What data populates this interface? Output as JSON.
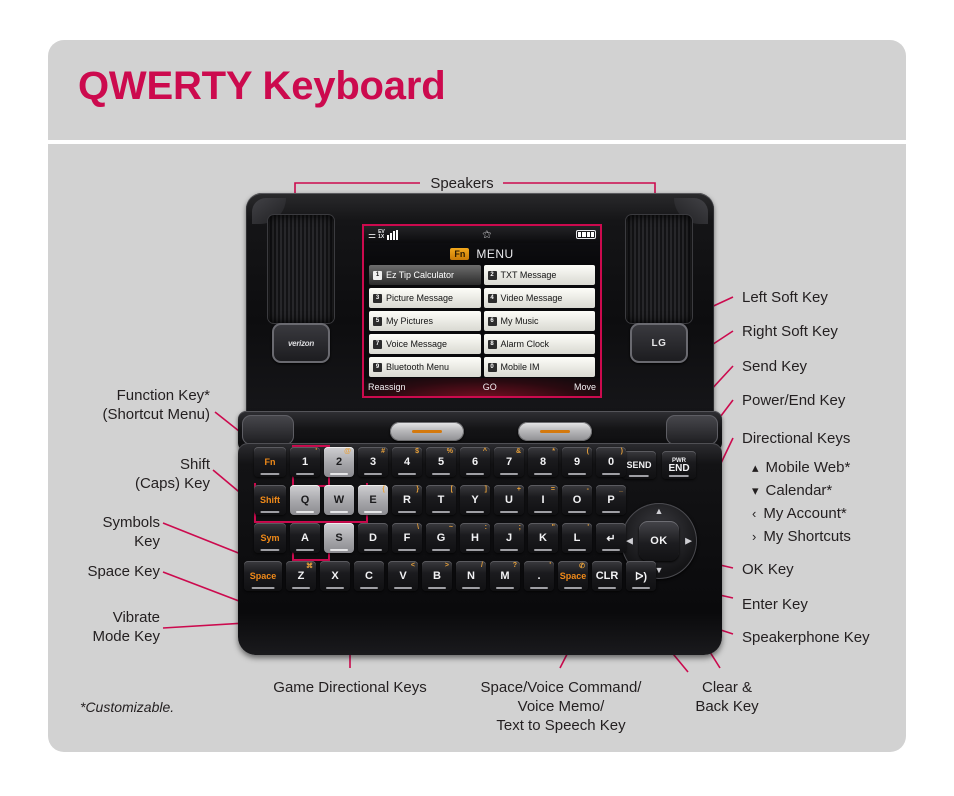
{
  "page": {
    "title": "QWERTY Keyboard",
    "accent_color": "#cc0a4e",
    "card_bg": "#d2d2d2",
    "footnote": "*Customizable."
  },
  "top_callout": {
    "speakers": "Speakers"
  },
  "phone": {
    "brand_left": "verizon",
    "brand_right": "LG",
    "screen": {
      "status": {
        "signal_icon": "antenna-icon",
        "network": "EV\n1X",
        "bars": 4,
        "gps_icon": "gps-crosshair-icon",
        "battery_icon": "battery-full-icon",
        "battery_level": 4
      },
      "header": {
        "fn_badge": "Fn",
        "title": "MENU"
      },
      "menu_items": [
        {
          "num": "1",
          "label": "Ez Tip Calculator",
          "selected": true
        },
        {
          "num": "2",
          "label": "TXT Message",
          "selected": false
        },
        {
          "num": "3",
          "label": "Picture Message",
          "selected": false
        },
        {
          "num": "4",
          "label": "Video Message",
          "selected": false
        },
        {
          "num": "5",
          "label": "My Pictures",
          "selected": false
        },
        {
          "num": "6",
          "label": "My Music",
          "selected": false
        },
        {
          "num": "7",
          "label": "Voice Message",
          "selected": false
        },
        {
          "num": "8",
          "label": "Alarm Clock",
          "selected": false
        },
        {
          "num": "9",
          "label": "Bluetooth Menu",
          "selected": false
        },
        {
          "num": "0",
          "label": "Mobile IM",
          "selected": false
        }
      ],
      "soft_bar": {
        "left": "Reassign",
        "center": "GO",
        "right": "Move"
      }
    },
    "keyboard": {
      "row1": [
        {
          "main": "Fn",
          "sup": "",
          "style": "orange"
        },
        {
          "main": "1",
          "sup": "'",
          "style": "dark"
        },
        {
          "main": "2",
          "sup": "@",
          "style": "lite"
        },
        {
          "main": "3",
          "sup": "#",
          "style": "dark"
        },
        {
          "main": "4",
          "sup": "$",
          "style": "dark"
        },
        {
          "main": "5",
          "sup": "%",
          "style": "dark"
        },
        {
          "main": "6",
          "sup": "^",
          "style": "dark"
        },
        {
          "main": "7",
          "sup": "&",
          "style": "dark"
        },
        {
          "main": "8",
          "sup": "*",
          "style": "dark"
        },
        {
          "main": "9",
          "sup": "(",
          "style": "dark"
        },
        {
          "main": "0",
          "sup": ")",
          "style": "dark"
        }
      ],
      "row2": [
        {
          "main": "Shift",
          "sup": "",
          "style": "orange"
        },
        {
          "main": "Q",
          "sup": "",
          "style": "lite"
        },
        {
          "main": "W",
          "sup": "",
          "style": "lite"
        },
        {
          "main": "E",
          "sup": "{",
          "style": "lite"
        },
        {
          "main": "R",
          "sup": "}",
          "style": "dark"
        },
        {
          "main": "T",
          "sup": "[",
          "style": "dark"
        },
        {
          "main": "Y",
          "sup": "]",
          "style": "dark"
        },
        {
          "main": "U",
          "sup": "+",
          "style": "dark"
        },
        {
          "main": "I",
          "sup": "=",
          "style": "dark"
        },
        {
          "main": "O",
          "sup": "-",
          "style": "dark"
        },
        {
          "main": "P",
          "sup": "_",
          "style": "dark"
        }
      ],
      "row3": [
        {
          "main": "Sym",
          "sup": "",
          "style": "orange"
        },
        {
          "main": "A",
          "sup": "",
          "style": "dark"
        },
        {
          "main": "S",
          "sup": "",
          "style": "lite"
        },
        {
          "main": "D",
          "sup": "",
          "style": "dark"
        },
        {
          "main": "F",
          "sup": "\\",
          "style": "dark"
        },
        {
          "main": "G",
          "sup": "~",
          "style": "dark"
        },
        {
          "main": "H",
          "sup": ":",
          "style": "dark"
        },
        {
          "main": "J",
          "sup": ";",
          "style": "dark"
        },
        {
          "main": "K",
          "sup": "\"",
          "style": "dark"
        },
        {
          "main": "L",
          "sup": "'",
          "style": "dark"
        },
        {
          "main": "↵",
          "sup": "",
          "style": "dark"
        }
      ],
      "row4": [
        {
          "main": "Space",
          "sup": "",
          "style": "orange"
        },
        {
          "main": "Z",
          "sup": "⌘",
          "style": "dark"
        },
        {
          "main": "X",
          "sup": "",
          "style": "dark"
        },
        {
          "main": "C",
          "sup": "",
          "style": "dark"
        },
        {
          "main": "V",
          "sup": "<",
          "style": "dark"
        },
        {
          "main": "B",
          "sup": ">",
          "style": "dark"
        },
        {
          "main": "N",
          "sup": "/",
          "style": "dark"
        },
        {
          "main": "M",
          "sup": "?",
          "style": "dark"
        },
        {
          "main": ".",
          "sup": "'",
          "style": "dark"
        },
        {
          "main": "Space",
          "sup": "✆",
          "style": "orange"
        },
        {
          "main": "CLR",
          "sup": "",
          "style": "dark"
        },
        {
          "main": "ᐅ)",
          "sup": "",
          "style": "dark"
        }
      ],
      "send_key": "SEND",
      "power_end_key": "PWR\nEND",
      "ok_key": "OK"
    }
  },
  "labels_left": [
    {
      "id": "function-key",
      "lines": [
        "Function Key*",
        "(Shortcut Menu)"
      ]
    },
    {
      "id": "shift-caps-key",
      "lines": [
        "Shift",
        "(Caps) Key"
      ]
    },
    {
      "id": "symbols-key",
      "lines": [
        "Symbols",
        "Key"
      ]
    },
    {
      "id": "space-key",
      "lines": [
        "Space Key"
      ]
    },
    {
      "id": "vibrate-mode-key",
      "lines": [
        "Vibrate",
        "Mode Key"
      ]
    }
  ],
  "labels_right": [
    {
      "id": "left-soft-key",
      "text": "Left Soft Key"
    },
    {
      "id": "right-soft-key",
      "text": "Right Soft Key"
    },
    {
      "id": "send-key",
      "text": "Send Key"
    },
    {
      "id": "power-end-key",
      "text": "Power/End Key"
    },
    {
      "id": "directional-keys",
      "text": "Directional Keys"
    },
    {
      "id": "ok-key",
      "text": "OK Key"
    },
    {
      "id": "enter-key",
      "text": "Enter Key"
    },
    {
      "id": "speakerphone-key",
      "text": "Speakerphone Key"
    }
  ],
  "directional_sub": [
    {
      "arrow": "▴",
      "text": "Mobile Web*"
    },
    {
      "arrow": "▾",
      "text": "Calendar*"
    },
    {
      "arrow": "‹",
      "text": "My Account*"
    },
    {
      "arrow": "›",
      "text": "My Shortcuts"
    }
  ],
  "labels_bottom": [
    {
      "id": "game-directional-keys",
      "lines": [
        "Game Directional Keys"
      ]
    },
    {
      "id": "space-voice-key",
      "lines": [
        "Space/Voice Command/",
        "Voice Memo/",
        "Text to Speech Key"
      ]
    },
    {
      "id": "clear-back-key",
      "lines": [
        "Clear &",
        "Back Key"
      ]
    }
  ]
}
